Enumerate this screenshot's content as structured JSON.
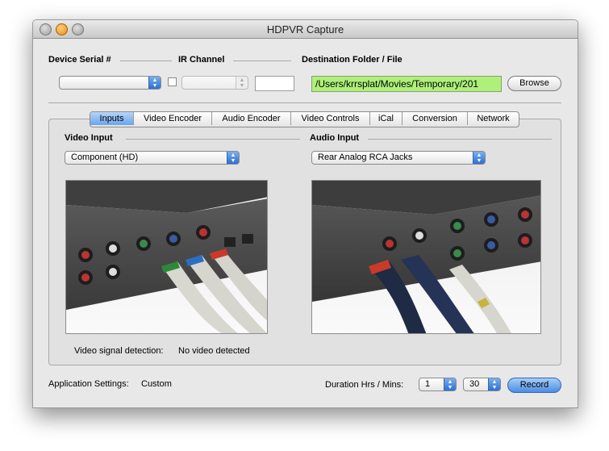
{
  "window": {
    "title": "HDPVR Capture"
  },
  "device": {
    "serial_label": "Device Serial #",
    "ir_label": "IR Channel",
    "dest_label": "Destination Folder / File",
    "dest_value": "/Users/krrsplat/Movies/Temporary/201",
    "browse_label": "Browse"
  },
  "tabs": [
    {
      "label": "Inputs",
      "active": true
    },
    {
      "label": "Video Encoder"
    },
    {
      "label": "Audio Encoder"
    },
    {
      "label": "Video Controls"
    },
    {
      "label": "iCal"
    },
    {
      "label": "Conversion"
    },
    {
      "label": "Network"
    }
  ],
  "inputs": {
    "video_label": "Video Input",
    "video_value": "Component (HD)",
    "audio_label": "Audio Input",
    "audio_value": "Rear Analog RCA Jacks",
    "signal_label": "Video signal detection:",
    "signal_value": "No video detected"
  },
  "footer": {
    "settings_label": "Application Settings:",
    "settings_value": "Custom",
    "duration_label": "Duration Hrs / Mins:",
    "hours": "1",
    "mins": "30",
    "record_label": "Record"
  },
  "colors": {
    "accent": "#4a8ee6",
    "dest_field": "#aef07a"
  }
}
